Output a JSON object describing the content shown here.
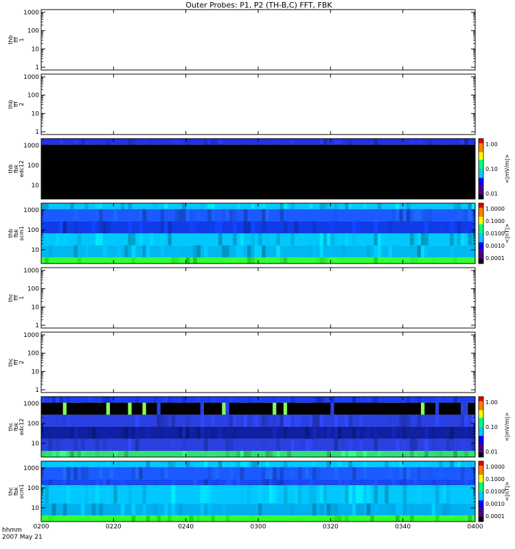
{
  "chart_data": {
    "type": "heatmap",
    "title": "Outer Probes: P1, P2 (TH-B,C) FFT, FBK",
    "x_axis": {
      "ticks": [
        "0200",
        "0220",
        "0240",
        "0300",
        "0320",
        "0340",
        "0400"
      ],
      "corner_label_1": "hhmm",
      "corner_label_2": "2007 May 21"
    },
    "y_ticks": [
      "1000",
      "100",
      "10",
      "1"
    ],
    "panels": [
      {
        "label": [
          "thb",
          "fff",
          "1"
        ],
        "kind": "empty",
        "y_ticks": [
          "1000",
          "100",
          "10",
          "1"
        ]
      },
      {
        "label": [
          "thb",
          "fff",
          "2"
        ],
        "kind": "empty",
        "y_ticks": [
          "1000",
          "100",
          "10",
          "1"
        ]
      },
      {
        "label": [
          "thb",
          "fbk",
          "edc12"
        ],
        "kind": "spectrogram",
        "y_ticks": [
          "1000",
          "100",
          "10"
        ],
        "colorbar": {
          "ticks": [
            "1.00",
            "0.10",
            "0.01"
          ],
          "label": "<|mV/m|>"
        },
        "bands": [
          {
            "rows": 1,
            "color": "#2332e8"
          },
          {
            "rows": 9,
            "color": "#000000"
          }
        ]
      },
      {
        "label": [
          "thb",
          "fbk",
          "scm1"
        ],
        "kind": "spectrogram",
        "y_ticks": [
          "1000",
          "100",
          "10"
        ],
        "colorbar": {
          "ticks": [
            "1.0000",
            "0.1000",
            "0.0100",
            "0.0010",
            "0.0001"
          ],
          "label": "<|nT|>"
        },
        "bands": [
          {
            "rows": 1,
            "color": "#00c8ff"
          },
          {
            "rows": 2,
            "color": "#1a5aff"
          },
          {
            "rows": 2,
            "color": "#0f3ce6"
          },
          {
            "rows": 2,
            "color": "#00c8ff"
          },
          {
            "rows": 2,
            "color": "#00b8f0"
          },
          {
            "rows": 1,
            "color": "#33ff33"
          }
        ]
      },
      {
        "label": [
          "thc",
          "fff",
          "1"
        ],
        "kind": "empty",
        "y_ticks": [
          "1000",
          "100",
          "10",
          "1"
        ]
      },
      {
        "label": [
          "thc",
          "fff",
          "2"
        ],
        "kind": "empty",
        "y_ticks": [
          "1000",
          "100",
          "10",
          "1"
        ]
      },
      {
        "label": [
          "thc",
          "fbk",
          "edc12"
        ],
        "kind": "spectrogram",
        "y_ticks": [
          "1000",
          "100",
          "10"
        ],
        "colorbar": {
          "ticks": [
            "1.00",
            "0.10",
            "0.01"
          ],
          "label": "<|mV/m|>"
        },
        "bands": [
          {
            "rows": 1,
            "color": "#1a3cff"
          },
          {
            "rows": 2,
            "color": "#000000"
          },
          {
            "rows": 2,
            "color": "#2a40e0"
          },
          {
            "rows": 2,
            "color": "#1020a0"
          },
          {
            "rows": 2,
            "color": "#2a40e0"
          },
          {
            "rows": 1,
            "color": "#30e070"
          }
        ]
      },
      {
        "label": [
          "thc",
          "fbk",
          "scm1"
        ],
        "kind": "spectrogram",
        "y_ticks": [
          "1000",
          "100",
          "10"
        ],
        "colorbar": {
          "ticks": [
            "1.0000",
            "0.1000",
            "0.0100",
            "0.0010",
            "0.0001"
          ],
          "label": "<|nT|>"
        },
        "bands": [
          {
            "rows": 1,
            "color": "#00c8ff"
          },
          {
            "rows": 2,
            "color": "#1a5aff"
          },
          {
            "rows": 1,
            "color": "#1848f0"
          },
          {
            "rows": 3,
            "color": "#00c8ff"
          },
          {
            "rows": 2,
            "color": "#00b0f0"
          },
          {
            "rows": 1,
            "color": "#33ff33"
          }
        ]
      }
    ],
    "colormap": [
      "#000000",
      "#4b0082",
      "#0000ff",
      "#00c8ff",
      "#00ff7f",
      "#ffff00",
      "#ff8000",
      "#e00000"
    ]
  }
}
